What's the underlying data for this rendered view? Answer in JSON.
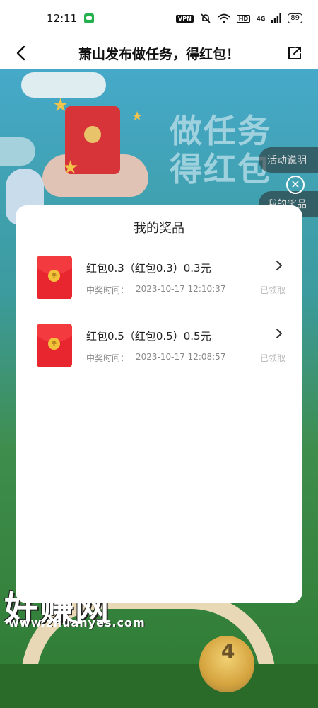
{
  "status_bar": {
    "time": "12:11",
    "vpn": "VPN",
    "hd": "HD",
    "signal": "4G",
    "battery": "89"
  },
  "title_bar": {
    "title": "萧山发布做任务，得红包！"
  },
  "background": {
    "banner_line1": "做任务",
    "banner_line2": "得红包",
    "side_tab_rules": "活动说明",
    "side_tab_prizes": "我的奖品",
    "coin_number": "4",
    "watermark_main": "好赚网",
    "watermark_sub": "www.zhuanyes.com"
  },
  "modal": {
    "title": "我的奖品",
    "items": [
      {
        "name": "红包0.3（红包0.3）0.3元",
        "time_label": "中奖时间：",
        "time": "2023-10-17 12:10:37",
        "status": "已领取",
        "coin_symbol": "¥"
      },
      {
        "name": "红包0.5（红包0.5）0.5元",
        "time_label": "中奖时间：",
        "time": "2023-10-17 12:08:57",
        "status": "已领取",
        "coin_symbol": "¥"
      }
    ]
  },
  "colors": {
    "accent_red": "#e8262f",
    "coin_gold": "#f3c13a",
    "status_gray": "#b5b5b5"
  },
  "icons": {
    "back": "chevron-left-icon",
    "share": "share-external-icon",
    "close": "close-icon",
    "item_arrow": "chevron-right-icon"
  }
}
